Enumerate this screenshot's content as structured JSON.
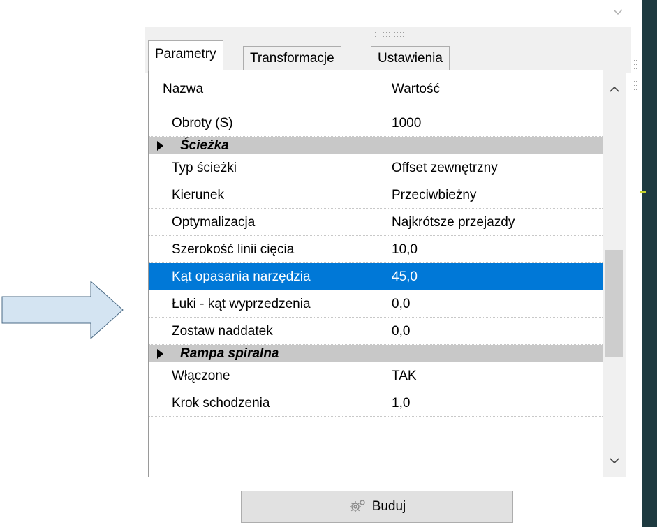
{
  "tabs": [
    {
      "label": "Parametry",
      "active": true
    },
    {
      "label": "Transformacje",
      "active": false
    },
    {
      "label": "Ustawienia",
      "active": false
    }
  ],
  "grid": {
    "header": {
      "name": "Nazwa",
      "value": "Wartość"
    },
    "rows": [
      {
        "type": "property",
        "name": "Obroty (S)",
        "value": "1000"
      },
      {
        "type": "category",
        "name": "Ścieżka"
      },
      {
        "type": "property",
        "name": "Typ ścieżki",
        "value": "Offset zewnętrzny"
      },
      {
        "type": "property",
        "name": "Kierunek",
        "value": "Przeciwbieżny"
      },
      {
        "type": "property",
        "name": "Optymalizacja",
        "value": "Najkrótsze przejazdy"
      },
      {
        "type": "property",
        "name": "Szerokość linii cięcia",
        "value": "10,0"
      },
      {
        "type": "property",
        "name": "Kąt opasania narzędzia",
        "value": "45,0",
        "selected": true
      },
      {
        "type": "property",
        "name": "Łuki - kąt wyprzedzenia",
        "value": "0,0"
      },
      {
        "type": "property",
        "name": "Zostaw naddatek",
        "value": "0,0"
      },
      {
        "type": "category",
        "name": "Rampa spiralna"
      },
      {
        "type": "property",
        "name": "Włączone",
        "value": "TAK"
      },
      {
        "type": "property",
        "name": "Krok schodzenia",
        "value": "1,0"
      }
    ]
  },
  "build_button": {
    "label": "Buduj",
    "icon": "gear-icon"
  },
  "colors": {
    "selection": "#0078d7",
    "category_band": "#c8c8c8",
    "arrow_fill": "#d4e4f2",
    "arrow_stroke": "#4a6a85",
    "right_strip": "#1e3a40"
  }
}
